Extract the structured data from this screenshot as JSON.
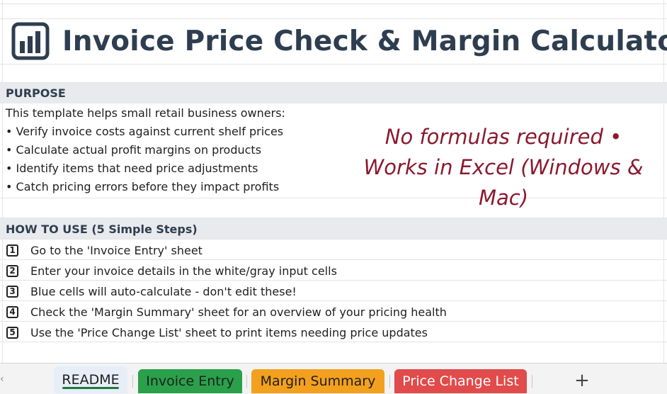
{
  "title": "Invoice Price Check & Margin Calculator",
  "purpose": {
    "heading": "PURPOSE",
    "intro": "This template helps small retail business owners:",
    "bullets": [
      "• Verify invoice costs against current shelf prices",
      "• Calculate actual profit margins on products",
      "• Identify items that need price adjustments",
      "• Catch pricing errors before they impact profits"
    ]
  },
  "note": {
    "line1": "No formulas required •",
    "line2": "Works in Excel (Windows &",
    "line3": "Mac)"
  },
  "how_to": {
    "heading": "HOW TO USE (5 Simple Steps)",
    "steps": [
      {
        "num": "1",
        "text": "Go to the 'Invoice Entry' sheet"
      },
      {
        "num": "2",
        "text": "Enter your invoice details in the white/gray input cells"
      },
      {
        "num": "3",
        "text": "Blue cells will auto-calculate - don't edit these!"
      },
      {
        "num": "4",
        "text": "Check the 'Margin Summary' sheet for an overview of your pricing health"
      },
      {
        "num": "5",
        "text": "Use the 'Price Change List' sheet to print items needing price updates"
      }
    ]
  },
  "tabs": [
    {
      "label": "README",
      "color": "#e7eef8"
    },
    {
      "label": "Invoice Entry",
      "color": "#2aa04a"
    },
    {
      "label": "Margin Summary",
      "color": "#f3a01f"
    },
    {
      "label": "Price Change List",
      "color": "#e14b4b"
    }
  ],
  "add_sheet_label": "+",
  "colors": {
    "title": "#2e3e50",
    "note": "#8b1a2f",
    "section_band": "#e8eaed"
  },
  "icons": {
    "title_icon": "bar-chart-icon",
    "add_sheet": "plus-icon"
  }
}
